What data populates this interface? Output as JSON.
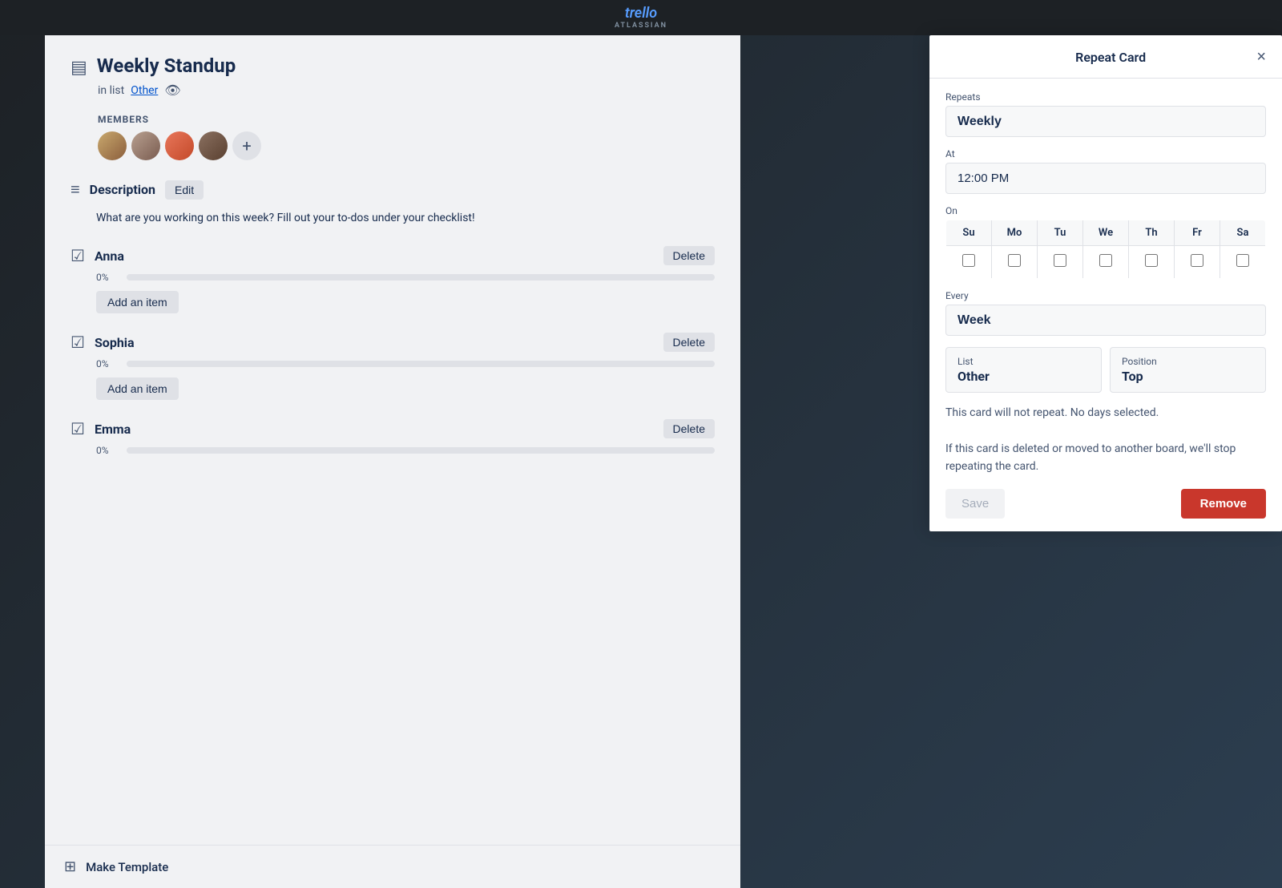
{
  "topbar": {
    "logo_brand": "trello",
    "logo_sub": "ATLASSIAN"
  },
  "card": {
    "title": "Weekly Standup",
    "subtitle_prefix": "in list",
    "list_name": "Other",
    "members_label": "MEMBERS",
    "description_title": "Description",
    "edit_button": "Edit",
    "description_text": "What are you working on this week? Fill out your to-dos under your checklist!",
    "checklists": [
      {
        "name": "Anna",
        "progress_pct": "0%",
        "progress_value": 0,
        "delete_label": "Delete",
        "add_item_label": "Add an item"
      },
      {
        "name": "Sophia",
        "progress_pct": "0%",
        "progress_value": 0,
        "delete_label": "Delete",
        "add_item_label": "Add an item"
      },
      {
        "name": "Emma",
        "progress_pct": "0%",
        "progress_value": 0,
        "delete_label": "Delete",
        "add_item_label": "Add an item"
      }
    ],
    "make_template_label": "Make Template"
  },
  "repeat_panel": {
    "title": "Repeat Card",
    "close_label": "×",
    "repeats_label": "Repeats",
    "repeats_value": "Weekly",
    "at_label": "At",
    "at_value": "12:00 PM",
    "on_label": "On",
    "days": [
      "Su",
      "Mo",
      "Tu",
      "We",
      "Th",
      "Fr",
      "Sa"
    ],
    "every_label": "Every",
    "every_value": "Week",
    "list_label": "List",
    "list_value": "Other",
    "position_label": "Position",
    "position_value": "Top",
    "info_line1": "This card will not repeat. No days selected.",
    "info_line2": "If this card is deleted or moved to another board, we'll stop repeating the card.",
    "save_label": "Save",
    "remove_label": "Remove"
  }
}
